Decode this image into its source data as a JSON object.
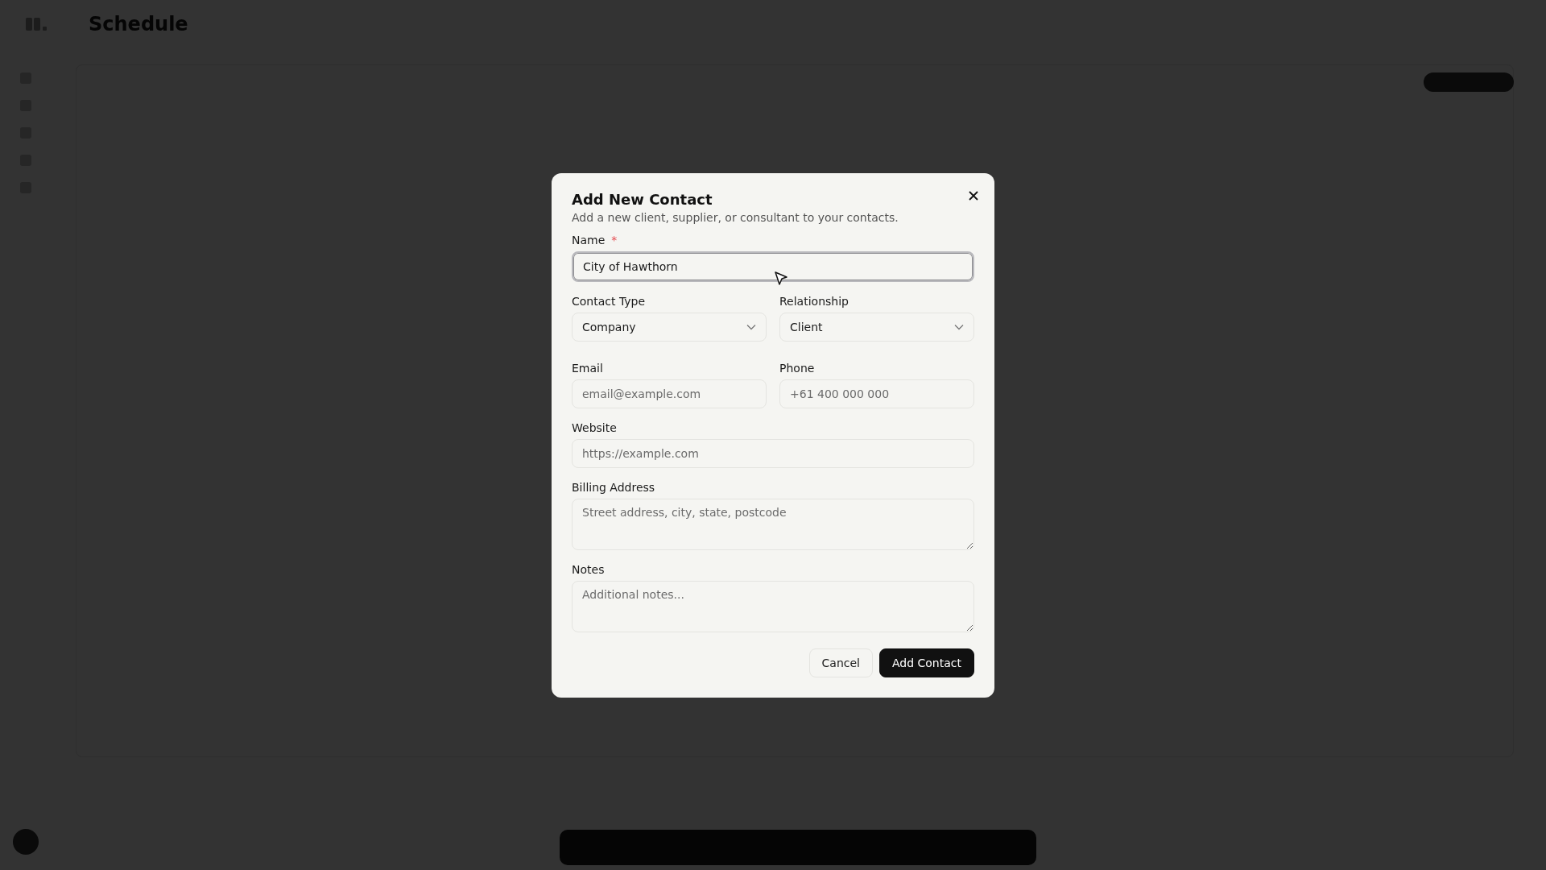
{
  "page": {
    "title": "Schedule"
  },
  "dialog": {
    "title": "Add New Contact",
    "description": "Add a new client, supplier, or consultant to your contacts.",
    "rows": [
      [
        {
          "kind": "text",
          "label": "Name",
          "required_mark": "*",
          "focused": true,
          "value": "City of Hawthorn"
        }
      ],
      [
        {
          "kind": "select",
          "label": "Contact Type",
          "focused": false,
          "value": "Company"
        },
        {
          "kind": "select",
          "label": "Relationship",
          "focused": false,
          "value": "Client"
        }
      ],
      [
        {
          "kind": "text",
          "label": "Email",
          "focused": false,
          "placeholder": "email@example.com"
        },
        {
          "kind": "text",
          "label": "Phone",
          "focused": false,
          "placeholder": "+61 400 000 000"
        }
      ],
      [
        {
          "kind": "text",
          "label": "Website",
          "focused": false,
          "placeholder": "https://example.com"
        }
      ],
      [
        {
          "kind": "textarea",
          "label": "Billing Address",
          "focused": false,
          "placeholder": "Street address, city, state, postcode"
        }
      ],
      [
        {
          "kind": "textarea",
          "label": "Notes",
          "focused": false,
          "placeholder": "Additional notes..."
        }
      ]
    ],
    "buttons": [
      {
        "kind": "secondary",
        "label": "Cancel"
      },
      {
        "kind": "primary",
        "label": "Add Contact"
      }
    ]
  }
}
